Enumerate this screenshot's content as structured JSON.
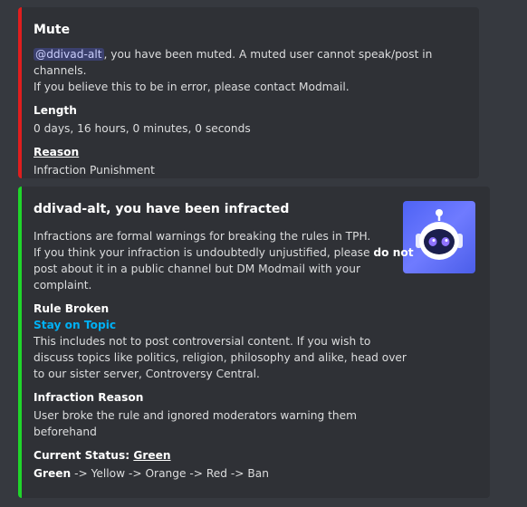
{
  "mute": {
    "title": "Mute",
    "mention": "@ddivad-alt",
    "description_line1_rest": ", you have been muted. A muted user cannot speak/post in channels.",
    "description_line2": "If you believe this to be in error, please contact Modmail.",
    "length_label": "Length",
    "length_value": "0 days, 16 hours, 0 minutes, 0 seconds",
    "reason_label": "Reason",
    "reason_value": "Infraction Punishment",
    "accent": "#e01e1e"
  },
  "infraction": {
    "title": "ddivad-alt, you have been infracted",
    "desc_line1": "Infractions are formal warnings for breaking the rules in TPH.",
    "desc_line2_pre": "If you think your infraction is undoubtedly unjustified, please ",
    "desc_line2_bold": "do not",
    "desc_line3": "post about it in a public channel but DM Modmail with your",
    "desc_line4": "complaint.",
    "rule_label": "Rule Broken",
    "rule_link": "Stay on Topic",
    "rule_line1": "This includes not to post controversial content. If you wish to",
    "rule_line2": "discuss topics like politics, religion, philosophy and alike, head over",
    "rule_line3": "to our sister server, Controversy Central.",
    "reason_label": "Infraction Reason",
    "reason_line1": "User broke the rule and ignored moderators warning them",
    "reason_line2": "beforehand",
    "status_label_pre": "Current Status: ",
    "status_label_value": "Green",
    "status_current": "Green",
    "status_rest": " -> Yellow -> Orange -> Red -> Ban",
    "thumbnail_icon": "robot-icon",
    "accent": "#1fd52a"
  }
}
